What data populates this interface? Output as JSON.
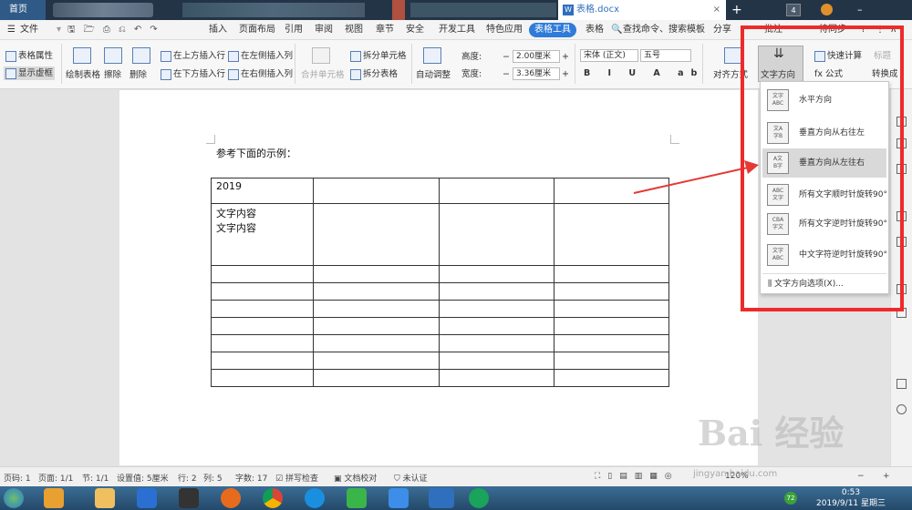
{
  "titlebar": {
    "home_tab": "首页",
    "doc_tab": "表格.docx",
    "notif_count": "4"
  },
  "menubar": {
    "file": "文件",
    "items": [
      "插入",
      "页面布局",
      "引用",
      "审阅",
      "视图",
      "章节",
      "安全",
      "开发工具",
      "特色应用",
      "表格工具",
      "表格"
    ],
    "search": "查找命令、搜索模板",
    "right": [
      "分享",
      "批注",
      "待同步"
    ]
  },
  "ribbon": {
    "table_props": "表格属性",
    "show_gridlines": "显示虚框",
    "draw_table": "绘制表格",
    "erase": "擦除",
    "delete": "删除",
    "insert_above": "在上方插入行",
    "insert_below": "在下方插入行",
    "insert_left": "在左侧插入列",
    "insert_right": "在右侧插入列",
    "merge_cells": "合并单元格",
    "split_cells": "拆分单元格",
    "split_table": "拆分表格",
    "autofit": "自动调整",
    "height_label": "高度:",
    "height_value": "2.00厘米",
    "width_label": "宽度:",
    "width_value": "3.36厘米",
    "font_name": "宋体 (正文)",
    "font_size": "五号",
    "align": "对齐方式",
    "text_direction": "文字方向",
    "quick_calc": "快速计算",
    "formula": "fx 公式",
    "title_row": "标题",
    "convert": "转换成"
  },
  "document": {
    "intro": "参考下面的示例：",
    "cell_year": "2019",
    "cell_text_1": "文字内容",
    "cell_text_2": "文字内容"
  },
  "dropdown": {
    "items": [
      {
        "label": "水平方向",
        "icon": "horizontal-text-icon"
      },
      {
        "label": "垂直方向从右往左",
        "icon": "vertical-rtl-icon"
      },
      {
        "label": "垂直方向从左往右",
        "icon": "vertical-ltr-icon"
      },
      {
        "label": "所有文字顺时针旋转90°",
        "icon": "rotate-cw-icon"
      },
      {
        "label": "所有文字逆时针旋转90°",
        "icon": "rotate-ccw-icon"
      },
      {
        "label": "中文字符逆时针旋转90°",
        "icon": "cjk-rotate-ccw-icon"
      }
    ],
    "selected_index": 2,
    "options_link": "文字方向选项(X)..."
  },
  "statusbar": {
    "page_num": "页码: 1",
    "pages": "页面: 1/1",
    "section": "节: 1/1",
    "setting": "设置值: 5厘米",
    "row": "行: 2",
    "col": "列: 5",
    "words": "字数: 17",
    "spell": "拼写检查",
    "proof": "文档校对",
    "cert": "未认证",
    "zoom": "120%"
  },
  "taskbar": {
    "time": "0:53",
    "date": "2019/9/11 星期三",
    "badge": "72"
  },
  "watermark": {
    "brand": "Bai 经验",
    "url": "jingyan.baidu.com"
  },
  "colors": {
    "accent": "#2f7bd8",
    "highlight_box": "#ee2a2a",
    "arrow": "#e53935"
  }
}
